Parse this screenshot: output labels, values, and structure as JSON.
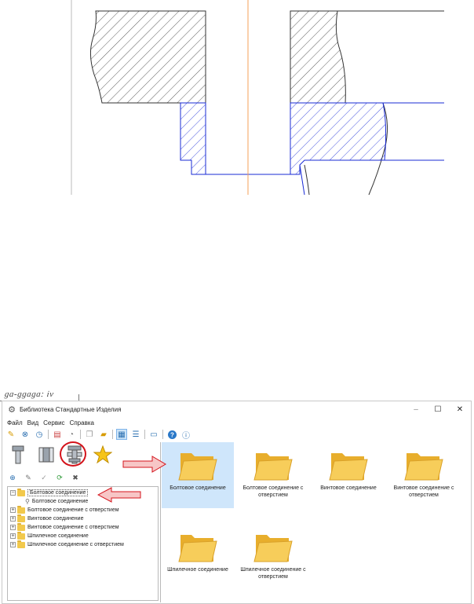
{
  "fragment_text": "ga-ggaga: iv",
  "window": {
    "title": "Библиотека Стандартные Изделия",
    "controls": {
      "minimize": "–",
      "maximize": "☐",
      "close": "✕"
    }
  },
  "menu": [
    "Файл",
    "Вид",
    "Сервис",
    "Справка"
  ],
  "toolbar": {
    "icons": [
      "pin-icon",
      "binoculars-icon",
      "clock-icon",
      "bookmark-icon",
      "paint-icon",
      "copy-icon",
      "folder-open-icon",
      "tiles-view-icon",
      "list-view-icon",
      "table-view-icon",
      "help-icon",
      "info-icon"
    ]
  },
  "tree": {
    "items": [
      {
        "label": "Болтовое соединение",
        "expander": "−",
        "selected": true
      },
      {
        "label": "Болтовое соединение",
        "child": true
      },
      {
        "label": "Болтовое соединение с отверстием",
        "expander": "+"
      },
      {
        "label": "Винтовое соединение",
        "expander": "+"
      },
      {
        "label": "Винтовое соединение с отверстием",
        "expander": "+"
      },
      {
        "label": "Шпилечное соединение",
        "expander": "+"
      },
      {
        "label": "Шпилечное соединение с отверстием",
        "expander": "+"
      }
    ]
  },
  "content": {
    "items": [
      {
        "label": "Болтовое соединение",
        "selected": true
      },
      {
        "label": "Болтовое соединение с отверстием"
      },
      {
        "label": "Винтовое соединение"
      },
      {
        "label": "Винтовое соединение с отверстием"
      },
      {
        "label": "Шпилечное соединение"
      },
      {
        "label": "Шпилечное соединение с отверстием"
      }
    ]
  },
  "colors": {
    "drawing_black": "#222222",
    "drawing_blue": "#1a2bd6",
    "axis_orange": "#f5a05a",
    "annotation_red": "#d4141c",
    "arrow_fill": "#f7c6c6",
    "folder": "#f2c94c",
    "selection": "#cfe6fb"
  }
}
